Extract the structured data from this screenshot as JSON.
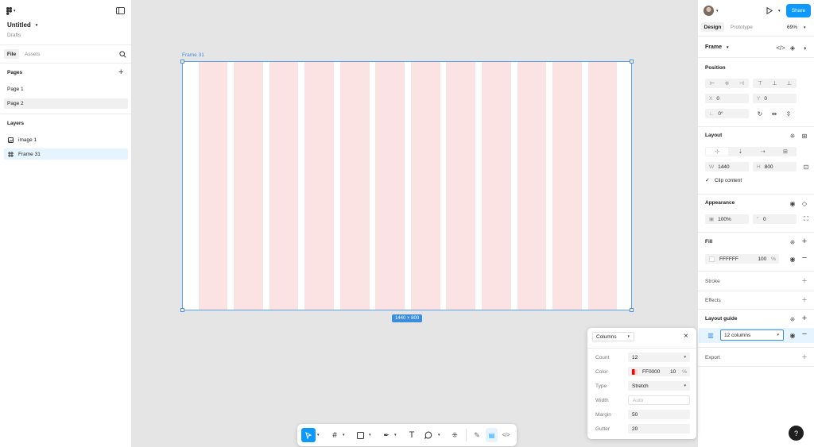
{
  "left_panel": {
    "file_title": "Untitled",
    "file_location": "Drafts",
    "tabs": [
      {
        "label": "File"
      },
      {
        "label": "Assets"
      }
    ],
    "pages_title": "Pages",
    "pages": [
      {
        "label": "Page 1"
      },
      {
        "label": "Page 2"
      }
    ],
    "layers_title": "Layers",
    "layers": [
      {
        "label": "image 1"
      },
      {
        "label": "Frame 31"
      }
    ]
  },
  "canvas": {
    "frame_label": "Frame 31",
    "size_badge": "1440 × 800",
    "column_count": 12
  },
  "right_panel": {
    "share_label": "Share",
    "tabs": [
      {
        "label": "Design"
      },
      {
        "label": "Prototype"
      }
    ],
    "zoom": "69%",
    "frame_title": "Frame",
    "position": {
      "title": "Position",
      "x_label": "X",
      "x": "0",
      "y_label": "Y",
      "y": "0",
      "rotation": "0°"
    },
    "layout": {
      "title": "Layout",
      "w_label": "W",
      "w": "1440",
      "h_label": "H",
      "h": "800",
      "clip_label": "Clip content"
    },
    "appearance": {
      "title": "Appearance",
      "opacity": "100%",
      "radius": "0"
    },
    "fill": {
      "title": "Fill",
      "hex": "FFFFFF",
      "opacity": "100",
      "pct": "%"
    },
    "stroke_title": "Stroke",
    "effects_title": "Effects",
    "layout_guide": {
      "title": "Layout guide",
      "value": "12 columns"
    },
    "export_title": "Export"
  },
  "popover": {
    "type_select": "Columns",
    "count_label": "Count",
    "count": "12",
    "color_label": "Color",
    "color_hex": "FF0000",
    "color_opacity": "10",
    "color_pct": "%",
    "type_label": "Type",
    "type": "Stretch",
    "width_label": "Width",
    "width_placeholder": "Auto",
    "margin_label": "Margin",
    "margin": "50",
    "gutter_label": "Gutter",
    "gutter": "20"
  },
  "help_label": "?",
  "colors": {
    "accent": "#0d99ff",
    "guide": "#ff0000",
    "selection": "#4a90e2"
  }
}
